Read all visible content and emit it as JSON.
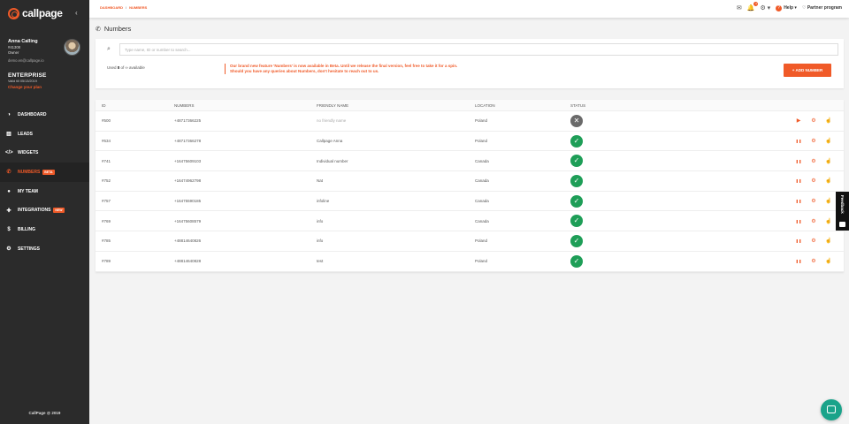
{
  "app": {
    "logo_text": "callpage"
  },
  "sidebar": {
    "collapse_icon": "chevron-left-icon",
    "user": {
      "name": "Anna Calling",
      "id": "#41308",
      "role": "Owner",
      "email": "demo.en@callpage.io"
    },
    "plan": {
      "name": "ENTERPRISE",
      "valid": "Valid till 05/13/2019",
      "change": "Change your plan"
    },
    "nav": [
      {
        "label": "DASHBOARD",
        "icon": "gauge-icon",
        "glyph": "◑"
      },
      {
        "label": "LEADS",
        "icon": "bars-icon",
        "glyph": "▥"
      },
      {
        "label": "WIDGETS",
        "icon": "code-icon",
        "glyph": "</>"
      },
      {
        "label": "NUMBERS",
        "icon": "phone-icon",
        "glyph": "✆",
        "badge": "BETA",
        "active": true
      },
      {
        "label": "MY TEAM",
        "icon": "user-icon",
        "glyph": "●"
      },
      {
        "label": "INTEGRATIONS",
        "icon": "puzzle-icon",
        "glyph": "✚",
        "badge": "NEW"
      },
      {
        "label": "BILLING",
        "icon": "dollar-icon",
        "glyph": "$"
      },
      {
        "label": "SETTINGS",
        "icon": "gear-icon",
        "glyph": "⚙"
      }
    ],
    "copyright": "CallPage @ 2019"
  },
  "topbar": {
    "breadcrumb": [
      "DASHBOARD",
      "NUMBERS"
    ],
    "notification_count": "4",
    "help_label": "Help",
    "partner_label": "Partner program"
  },
  "page": {
    "title": "Numbers"
  },
  "search": {
    "placeholder": "Type name, ID or number to search..."
  },
  "usage": {
    "prefix": "Used ",
    "count": "8",
    "suffix": " of ∞ available"
  },
  "beta_note": {
    "line1": "Our brand new feature 'Numbers' is now available in Beta. Until we release the final version, feel free to take it for a spin.",
    "line2": "Should you have any queries about Numbers, don't hesitate to reach out to us."
  },
  "add_button": "+ ADD NUMBER",
  "table": {
    "headers": [
      "ID",
      "NUMBERS",
      "FRIENDLY NAME",
      "LOCATION",
      "STATUS"
    ],
    "rows": [
      {
        "id": "#500",
        "number": "+48717366225",
        "name": "no friendly name",
        "location": "Poland",
        "status": "inactive"
      },
      {
        "id": "#634",
        "number": "+48717366278",
        "name": "Callpage Anna",
        "location": "Poland",
        "status": "active"
      },
      {
        "id": "#741",
        "number": "+16475609103",
        "name": "Individual number",
        "location": "Canada",
        "status": "active"
      },
      {
        "id": "#752",
        "number": "+16474962798",
        "name": "Nat",
        "location": "Canada",
        "status": "active"
      },
      {
        "id": "#757",
        "number": "+16475590185",
        "name": "infoline",
        "location": "Canada",
        "status": "active"
      },
      {
        "id": "#769",
        "number": "+16475608579",
        "name": "info",
        "location": "Canada",
        "status": "active"
      },
      {
        "id": "#785",
        "number": "+48814640826",
        "name": "info",
        "location": "Poland",
        "status": "active"
      },
      {
        "id": "#789",
        "number": "+48814640828",
        "name": "test",
        "location": "Poland",
        "status": "active"
      }
    ]
  },
  "feedback": {
    "label": "Feedback"
  },
  "colors": {
    "accent": "#f05a28",
    "sidebar": "#2b2b2b",
    "success": "#1e9e57",
    "chat": "#1aa38a"
  }
}
